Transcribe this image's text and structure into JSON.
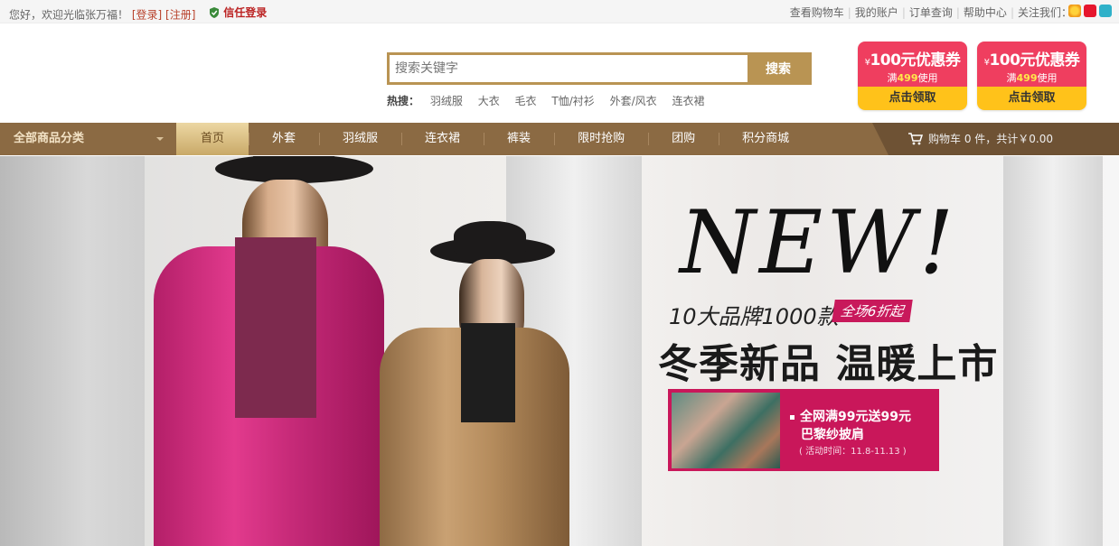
{
  "topbar": {
    "greeting": "您好，欢迎光临张万福！",
    "login": "[登录]",
    "register": "[注册]",
    "trust_login": "信任登录",
    "links": [
      "查看购物车",
      "我的账户",
      "订单查询",
      "帮助中心",
      "关注我们："
    ],
    "social_icons": [
      "qzone-icon",
      "weibo-icon",
      "tencent-weibo-icon"
    ]
  },
  "search": {
    "placeholder": "搜索关键字",
    "button": "搜索",
    "hot_label": "热搜：",
    "hot_words": [
      "羽绒服",
      "大衣",
      "毛衣",
      "T恤/衬衫",
      "外套/风衣",
      "连衣裙"
    ]
  },
  "coupons": [
    {
      "yen": "¥",
      "amount": "100元优惠券",
      "cond_pre": "满",
      "cond_num": "499",
      "cond_post": "使用",
      "action": "点击领取"
    },
    {
      "yen": "¥",
      "amount": "100元优惠券",
      "cond_pre": "满",
      "cond_num": "499",
      "cond_post": "使用",
      "action": "点击领取"
    }
  ],
  "nav": {
    "all_categories": "全部商品分类",
    "items": [
      "首页",
      "外套",
      "羽绒服",
      "连衣裙",
      "裤装",
      "限时抢购",
      "团购",
      "积分商城"
    ],
    "cart": "购物车 0 件，共计￥0.00"
  },
  "banner": {
    "headline": "NEW!",
    "brands": "10大品牌1000款",
    "discount": "全场6折起",
    "slogan": "冬季新品 温暖上市",
    "promo_line1": "全网满99元送99元",
    "promo_line2": "巴黎纱披肩",
    "promo_time": "( 活动时间：11.8-11.13 )"
  },
  "colors": {
    "nav_bg": "#8b6a43",
    "accent_gold": "#b99453",
    "coupon_red": "#ef3e5f",
    "promo_pink": "#c9175a"
  }
}
